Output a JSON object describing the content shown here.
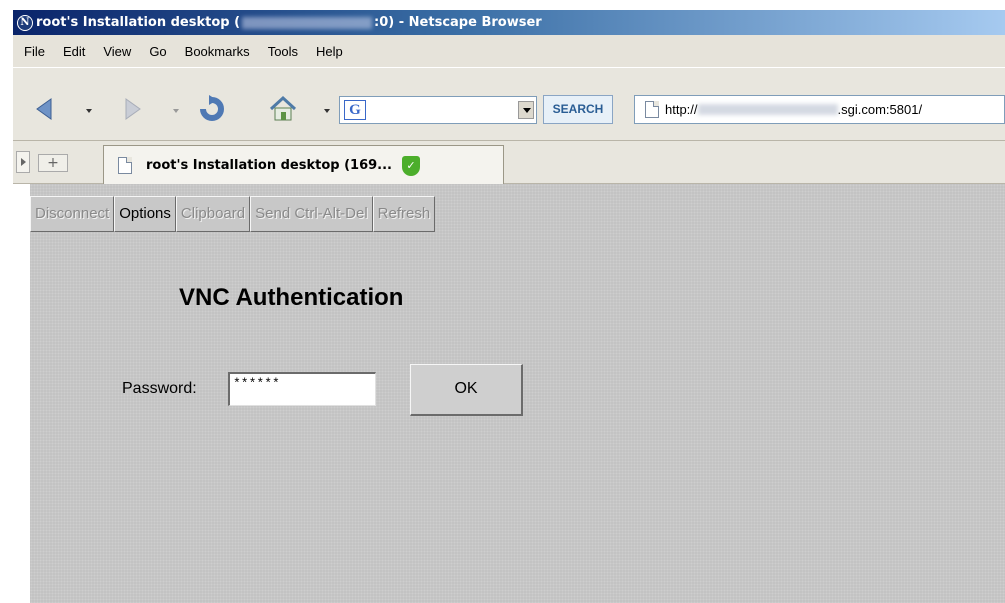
{
  "window": {
    "title_prefix": "root's Installation desktop (",
    "title_suffix": ":0) - Netscape Browser",
    "logo_letter": "N"
  },
  "menu": [
    "File",
    "Edit",
    "View",
    "Go",
    "Bookmarks",
    "Tools",
    "Help"
  ],
  "toolbar": {
    "search_label": "SEARCH",
    "search_engine_letter": "G",
    "url_prefix": "http://",
    "url_suffix": ".sgi.com:5801/"
  },
  "tabs": {
    "new_tab_label": "+",
    "items": [
      {
        "label": "root's Installation desktop (169..."
      }
    ]
  },
  "vnc": {
    "buttons": [
      {
        "label": "Disconnect",
        "enabled": false
      },
      {
        "label": "Options",
        "enabled": true
      },
      {
        "label": "Clipboard",
        "enabled": false
      },
      {
        "label": "Send Ctrl-Alt-Del",
        "enabled": false
      },
      {
        "label": "Refresh",
        "enabled": false
      }
    ],
    "title": "VNC Authentication",
    "password_label": "Password:",
    "password_value": "******",
    "ok_label": "OK"
  },
  "colors": {
    "titlebar_start": "#0a246a",
    "applet_bg": "#c3c3c3",
    "search_text": "#2a5d94",
    "secure_green": "#4cae2b"
  },
  "icons": [
    "back-arrow-icon",
    "forward-arrow-icon",
    "reload-icon",
    "home-icon",
    "search-engine-icon",
    "page-icon",
    "security-shield-icon"
  ]
}
